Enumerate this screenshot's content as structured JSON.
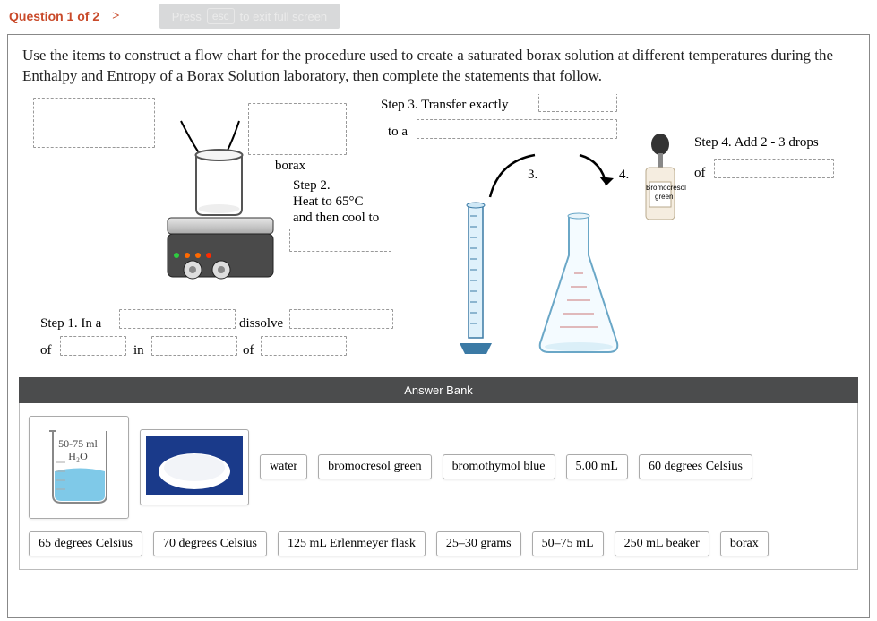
{
  "header": {
    "question_label": "Question 1 of 2",
    "chevron": ">",
    "esc_pre": "Press",
    "esc_key": "esc",
    "esc_post": "to exit full screen"
  },
  "instructions": "Use the items to construct a flow chart for the procedure used to create a saturated borax solution at different temperatures during the Enthalpy and Entropy of a Borax Solution laboratory, then complete the statements that follow.",
  "diagram": {
    "borax_label": "borax",
    "step2_line1": "Step 2.",
    "step2_line2": "Heat to 65°C",
    "step2_line3": "and then cool to",
    "step1_pre": "Step 1.  In a",
    "step1_dissolve": "dissolve",
    "step1_of": "of",
    "step1_in": "in",
    "step1_of2": "of",
    "step3_line1": "Step 3.  Transfer exactly",
    "step3_toa": "to a",
    "label_3": "3.",
    "label_4": "4.",
    "step4_line1": "Step 4.  Add 2 - 3 drops",
    "step4_of": "of",
    "bromo_label1": "Bromocresol",
    "bromo_label2": "green"
  },
  "answer_bank": {
    "title": "Answer Bank",
    "beaker_line1": "50-75 ml",
    "beaker_line2": "H₂O",
    "items_row1": [
      "water",
      "bromocresol green",
      "bromothymol blue",
      "5.00 mL",
      "60 degrees Celsius"
    ],
    "items_row2": [
      "65 degrees Celsius",
      "70 degrees Celsius",
      "125 mL Erlenmeyer flask",
      "25–30 grams",
      "50–75 mL",
      "250 mL beaker",
      "borax"
    ]
  }
}
